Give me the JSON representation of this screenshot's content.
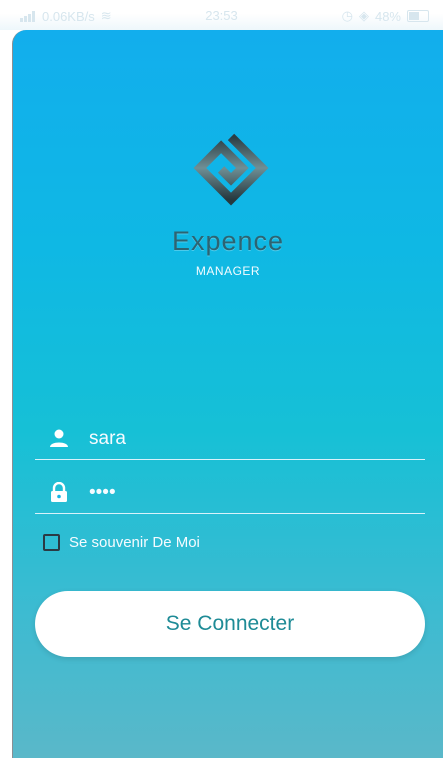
{
  "status_bar": {
    "network": "0.06KB/s",
    "time": "23:53",
    "battery": "48%"
  },
  "app": {
    "brand_title": "Expence",
    "brand_subtitle": "MANAGER"
  },
  "login": {
    "username": "sara",
    "password_mask": "••••",
    "remember_label": "Se souvenir De Moi",
    "remember_checked": false,
    "submit_label": "Se Connecter"
  },
  "colors": {
    "gradient_top": "#12aeed",
    "gradient_bottom": "#5ab8c9",
    "brand_text": "#2d6472",
    "button_text": "#1e8b96"
  },
  "icons": {
    "username": "person-icon",
    "password": "lock-icon",
    "logo": "app-logo-icon"
  }
}
